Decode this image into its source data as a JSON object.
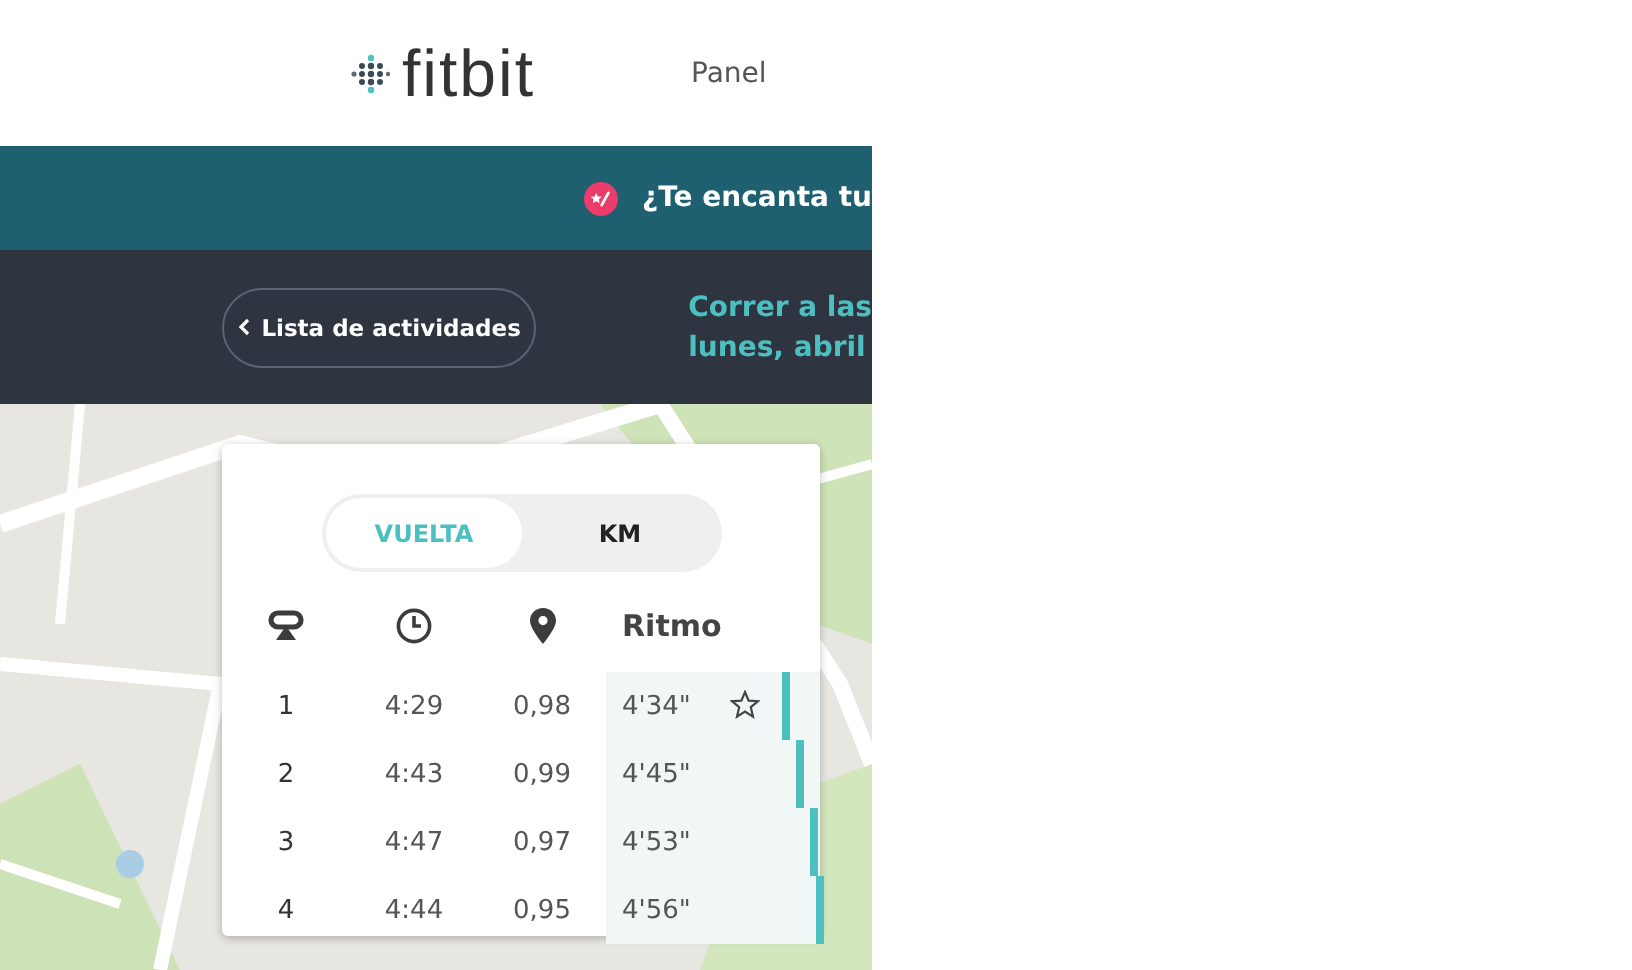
{
  "header": {
    "logo": "fitbit",
    "nav": [
      {
        "label": "Panel"
      }
    ]
  },
  "banner": {
    "text": "¿Te encanta tu"
  },
  "activity_bar": {
    "back_button": "Lista de actividades",
    "title_lines": [
      "Correr a las",
      "lunes, abril"
    ]
  },
  "splits": {
    "toggle": [
      {
        "label": "VUELTA",
        "selected": true
      },
      {
        "label": "KM",
        "selected": false
      }
    ],
    "pace_heading": "Ritmo",
    "rows": [
      {
        "lap": "1",
        "time": "4:29",
        "distance": "0,98",
        "pace": "4'34\"",
        "best": true,
        "level": 0.82
      },
      {
        "lap": "2",
        "time": "4:43",
        "distance": "0,99",
        "pace": "4'45\"",
        "best": false,
        "level": 0.89
      },
      {
        "lap": "3",
        "time": "4:47",
        "distance": "0,97",
        "pace": "4'53\"",
        "best": false,
        "level": 0.95
      },
      {
        "lap": "4",
        "time": "4:44",
        "distance": "0,95",
        "pace": "4'56\"",
        "best": false,
        "level": 0.98
      }
    ]
  }
}
